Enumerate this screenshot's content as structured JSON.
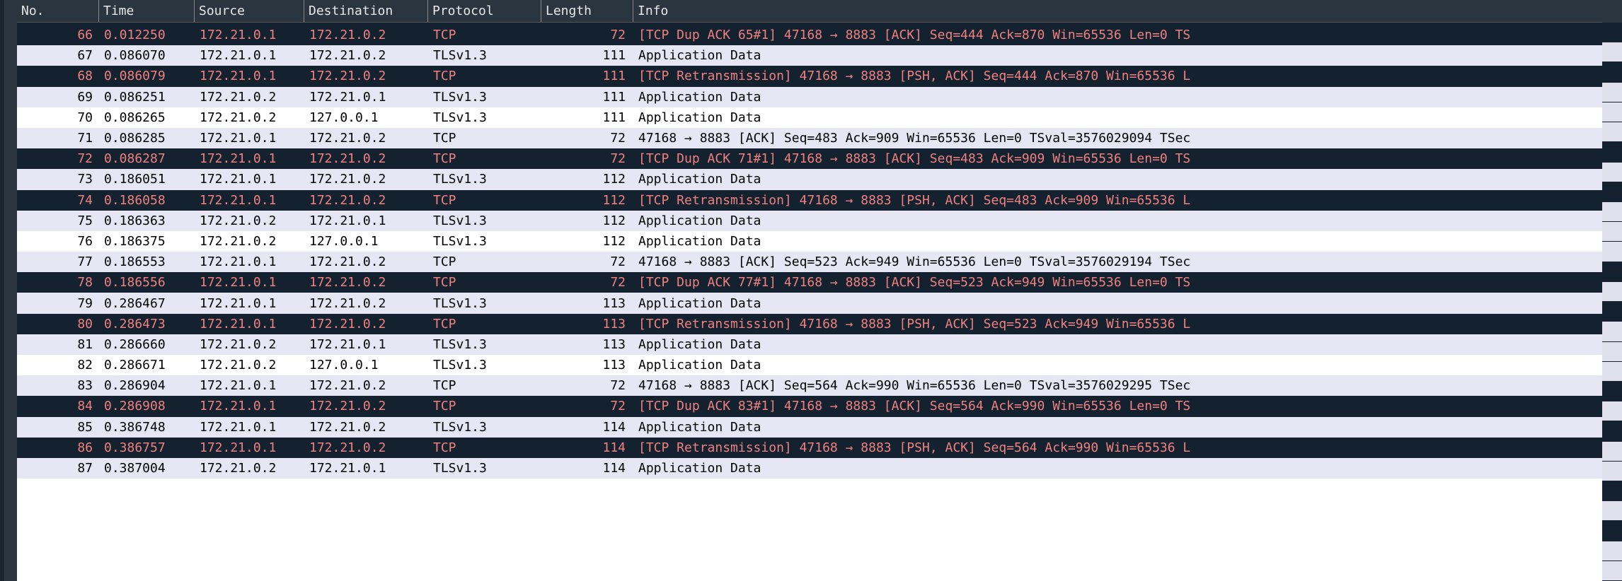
{
  "headers": {
    "no": "No.",
    "time": "Time",
    "source": "Source",
    "destination": "Destination",
    "protocol": "Protocol",
    "length": "Length",
    "info": "Info"
  },
  "packets": [
    {
      "no": "66",
      "time": "0.012250",
      "src": "172.21.0.1",
      "dst": "172.21.0.2",
      "proto": "TCP",
      "len": "72",
      "info": "[TCP Dup ACK 65#1] 47168 → 8883 [ACK] Seq=444 Ack=870 Win=65536 Len=0 TS",
      "style": "dark"
    },
    {
      "no": "67",
      "time": "0.086070",
      "src": "172.21.0.1",
      "dst": "172.21.0.2",
      "proto": "TLSv1.3",
      "len": "111",
      "info": "Application Data",
      "style": "light"
    },
    {
      "no": "68",
      "time": "0.086079",
      "src": "172.21.0.1",
      "dst": "172.21.0.2",
      "proto": "TCP",
      "len": "111",
      "info": "[TCP Retransmission] 47168 → 8883 [PSH, ACK] Seq=444 Ack=870 Win=65536 L",
      "style": "dark"
    },
    {
      "no": "69",
      "time": "0.086251",
      "src": "172.21.0.2",
      "dst": "172.21.0.1",
      "proto": "TLSv1.3",
      "len": "111",
      "info": "Application Data",
      "style": "light"
    },
    {
      "no": "70",
      "time": "0.086265",
      "src": "172.21.0.2",
      "dst": "127.0.0.1",
      "proto": "TLSv1.3",
      "len": "111",
      "info": "Application Data",
      "style": "white"
    },
    {
      "no": "71",
      "time": "0.086285",
      "src": "172.21.0.1",
      "dst": "172.21.0.2",
      "proto": "TCP",
      "len": "72",
      "info": "47168 → 8883 [ACK] Seq=483 Ack=909 Win=65536 Len=0 TSval=3576029094 TSec",
      "style": "light"
    },
    {
      "no": "72",
      "time": "0.086287",
      "src": "172.21.0.1",
      "dst": "172.21.0.2",
      "proto": "TCP",
      "len": "72",
      "info": "[TCP Dup ACK 71#1] 47168 → 8883 [ACK] Seq=483 Ack=909 Win=65536 Len=0 TS",
      "style": "dark"
    },
    {
      "no": "73",
      "time": "0.186051",
      "src": "172.21.0.1",
      "dst": "172.21.0.2",
      "proto": "TLSv1.3",
      "len": "112",
      "info": "Application Data",
      "style": "light"
    },
    {
      "no": "74",
      "time": "0.186058",
      "src": "172.21.0.1",
      "dst": "172.21.0.2",
      "proto": "TCP",
      "len": "112",
      "info": "[TCP Retransmission] 47168 → 8883 [PSH, ACK] Seq=483 Ack=909 Win=65536 L",
      "style": "dark"
    },
    {
      "no": "75",
      "time": "0.186363",
      "src": "172.21.0.2",
      "dst": "172.21.0.1",
      "proto": "TLSv1.3",
      "len": "112",
      "info": "Application Data",
      "style": "light"
    },
    {
      "no": "76",
      "time": "0.186375",
      "src": "172.21.0.2",
      "dst": "127.0.0.1",
      "proto": "TLSv1.3",
      "len": "112",
      "info": "Application Data",
      "style": "white"
    },
    {
      "no": "77",
      "time": "0.186553",
      "src": "172.21.0.1",
      "dst": "172.21.0.2",
      "proto": "TCP",
      "len": "72",
      "info": "47168 → 8883 [ACK] Seq=523 Ack=949 Win=65536 Len=0 TSval=3576029194 TSec",
      "style": "light"
    },
    {
      "no": "78",
      "time": "0.186556",
      "src": "172.21.0.1",
      "dst": "172.21.0.2",
      "proto": "TCP",
      "len": "72",
      "info": "[TCP Dup ACK 77#1] 47168 → 8883 [ACK] Seq=523 Ack=949 Win=65536 Len=0 TS",
      "style": "dark"
    },
    {
      "no": "79",
      "time": "0.286467",
      "src": "172.21.0.1",
      "dst": "172.21.0.2",
      "proto": "TLSv1.3",
      "len": "113",
      "info": "Application Data",
      "style": "light"
    },
    {
      "no": "80",
      "time": "0.286473",
      "src": "172.21.0.1",
      "dst": "172.21.0.2",
      "proto": "TCP",
      "len": "113",
      "info": "[TCP Retransmission] 47168 → 8883 [PSH, ACK] Seq=523 Ack=949 Win=65536 L",
      "style": "dark"
    },
    {
      "no": "81",
      "time": "0.286660",
      "src": "172.21.0.2",
      "dst": "172.21.0.1",
      "proto": "TLSv1.3",
      "len": "113",
      "info": "Application Data",
      "style": "light"
    },
    {
      "no": "82",
      "time": "0.286671",
      "src": "172.21.0.2",
      "dst": "127.0.0.1",
      "proto": "TLSv1.3",
      "len": "113",
      "info": "Application Data",
      "style": "white"
    },
    {
      "no": "83",
      "time": "0.286904",
      "src": "172.21.0.1",
      "dst": "172.21.0.2",
      "proto": "TCP",
      "len": "72",
      "info": "47168 → 8883 [ACK] Seq=564 Ack=990 Win=65536 Len=0 TSval=3576029295 TSec",
      "style": "light"
    },
    {
      "no": "84",
      "time": "0.286908",
      "src": "172.21.0.1",
      "dst": "172.21.0.2",
      "proto": "TCP",
      "len": "72",
      "info": "[TCP Dup ACK 83#1] 47168 → 8883 [ACK] Seq=564 Ack=990 Win=65536 Len=0 TS",
      "style": "dark"
    },
    {
      "no": "85",
      "time": "0.386748",
      "src": "172.21.0.1",
      "dst": "172.21.0.2",
      "proto": "TLSv1.3",
      "len": "114",
      "info": "Application Data",
      "style": "light"
    },
    {
      "no": "86",
      "time": "0.386757",
      "src": "172.21.0.1",
      "dst": "172.21.0.2",
      "proto": "TCP",
      "len": "114",
      "info": "[TCP Retransmission] 47168 → 8883 [PSH, ACK] Seq=564 Ack=990 Win=65536 L",
      "style": "dark"
    },
    {
      "no": "87",
      "time": "0.387004",
      "src": "172.21.0.2",
      "dst": "172.21.0.1",
      "proto": "TLSv1.3",
      "len": "114",
      "info": "Application Data",
      "style": "light"
    }
  ],
  "overview": [
    "dark",
    "light",
    "dark",
    "light",
    "light",
    "light",
    "dark",
    "light",
    "dark",
    "light",
    "light",
    "light",
    "dark",
    "light",
    "dark",
    "light",
    "light",
    "light",
    "dark",
    "light",
    "dark",
    "light",
    "light",
    "dark",
    "light",
    "dark",
    "light",
    "light"
  ]
}
